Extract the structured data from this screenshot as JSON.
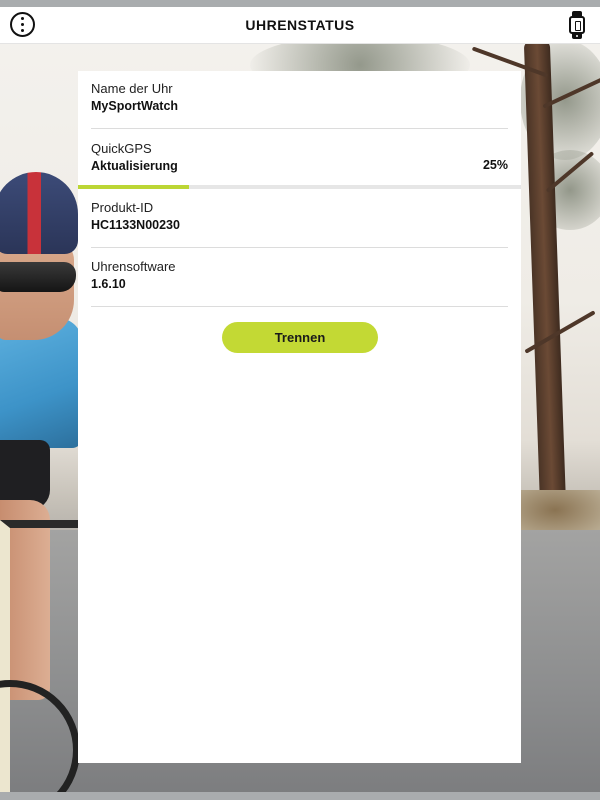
{
  "header": {
    "title": "UHRENSTATUS",
    "menu_icon": "more-options-icon",
    "watch_icon": "watch-icon"
  },
  "status": {
    "watch_name": {
      "label": "Name der Uhr",
      "value": "MySportWatch"
    },
    "quickgps": {
      "label": "QuickGPS",
      "value": "Aktualisierung",
      "percent_text": "25%",
      "progress_fraction": 0.25
    },
    "product_id": {
      "label": "Produkt-ID",
      "value": "HC1133N00230"
    },
    "software": {
      "label": "Uhrensoftware",
      "value": "1.6.10"
    }
  },
  "actions": {
    "disconnect_label": "Trennen"
  },
  "colors": {
    "accent": "#c3d934",
    "progress": "#bcd635",
    "progress_track": "#e6e6e6",
    "panel_background": "#ffffff"
  }
}
